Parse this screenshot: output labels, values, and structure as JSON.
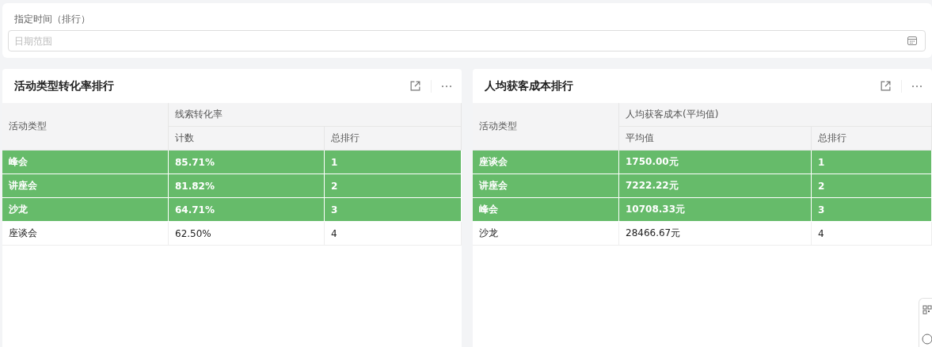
{
  "filter": {
    "label": "指定时间（排行）",
    "date_field": {
      "placeholder": "日期范围"
    }
  },
  "panels": [
    {
      "title": "活动类型转化率排行",
      "group_header": "线索转化率",
      "columns": [
        "活动类型",
        "计数",
        "总排行"
      ],
      "rows": [
        {
          "cells": [
            "峰会",
            "85.71%",
            "1"
          ],
          "highlighted": true
        },
        {
          "cells": [
            "讲座会",
            "81.82%",
            "2"
          ],
          "highlighted": true
        },
        {
          "cells": [
            "沙龙",
            "64.71%",
            "3"
          ],
          "highlighted": true
        },
        {
          "cells": [
            "座谈会",
            "62.50%",
            "4"
          ],
          "highlighted": false
        }
      ]
    },
    {
      "title": "人均获客成本排行",
      "group_header": "人均获客成本(平均值)",
      "columns": [
        "活动类型",
        "平均值",
        "总排行"
      ],
      "rows": [
        {
          "cells": [
            "座谈会",
            "1750.00元",
            "1"
          ],
          "highlighted": true
        },
        {
          "cells": [
            "讲座会",
            "7222.22元",
            "2"
          ],
          "highlighted": true
        },
        {
          "cells": [
            "峰会",
            "10708.33元",
            "3"
          ],
          "highlighted": true
        },
        {
          "cells": [
            "沙龙",
            "28466.67元",
            "4"
          ],
          "highlighted": false
        }
      ]
    }
  ]
}
